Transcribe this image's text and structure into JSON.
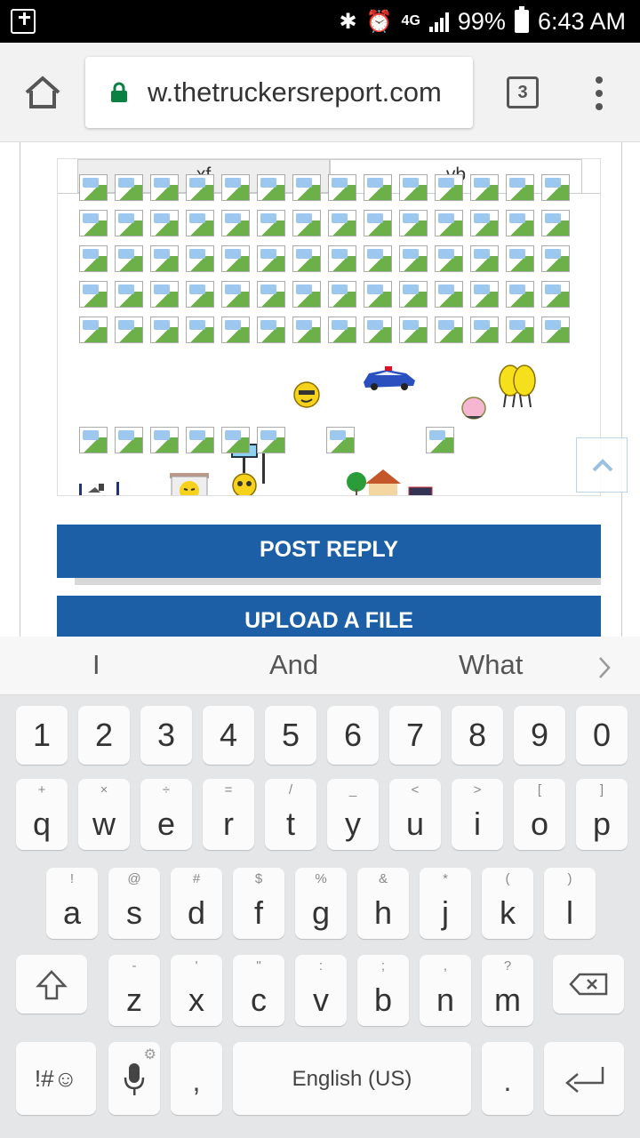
{
  "status_bar": {
    "network": "4G",
    "battery_percent": "99%",
    "time": "6:43 AM"
  },
  "browser": {
    "url": "w.thetruckersreport.com",
    "tab_count": "3"
  },
  "smilie_tabs": [
    "xf",
    "vb"
  ],
  "buttons": {
    "post_reply": "POST REPLY",
    "upload_file": "UPLOAD A FILE"
  },
  "suggestions": [
    "I",
    "And",
    "What"
  ],
  "keyboard": {
    "number_row": [
      "1",
      "2",
      "3",
      "4",
      "5",
      "6",
      "7",
      "8",
      "9",
      "0"
    ],
    "row1": [
      {
        "key": "q",
        "hint": "+"
      },
      {
        "key": "w",
        "hint": "×"
      },
      {
        "key": "e",
        "hint": "÷"
      },
      {
        "key": "r",
        "hint": "="
      },
      {
        "key": "t",
        "hint": "/"
      },
      {
        "key": "y",
        "hint": "_"
      },
      {
        "key": "u",
        "hint": "<"
      },
      {
        "key": "i",
        "hint": ">"
      },
      {
        "key": "o",
        "hint": "["
      },
      {
        "key": "p",
        "hint": "]"
      }
    ],
    "row2": [
      {
        "key": "a",
        "hint": "!"
      },
      {
        "key": "s",
        "hint": "@"
      },
      {
        "key": "d",
        "hint": "#"
      },
      {
        "key": "f",
        "hint": "$"
      },
      {
        "key": "g",
        "hint": "%"
      },
      {
        "key": "h",
        "hint": "&"
      },
      {
        "key": "j",
        "hint": "*"
      },
      {
        "key": "k",
        "hint": "("
      },
      {
        "key": "l",
        "hint": ")"
      }
    ],
    "row3": [
      {
        "key": "z",
        "hint": "-"
      },
      {
        "key": "x",
        "hint": "'"
      },
      {
        "key": "c",
        "hint": "\""
      },
      {
        "key": "v",
        "hint": ":"
      },
      {
        "key": "b",
        "hint": ";"
      },
      {
        "key": "n",
        "hint": ","
      },
      {
        "key": "m",
        "hint": "?"
      }
    ],
    "symbols_label": "!#☺",
    "comma": ",",
    "space_label": "English (US)",
    "period": "."
  }
}
